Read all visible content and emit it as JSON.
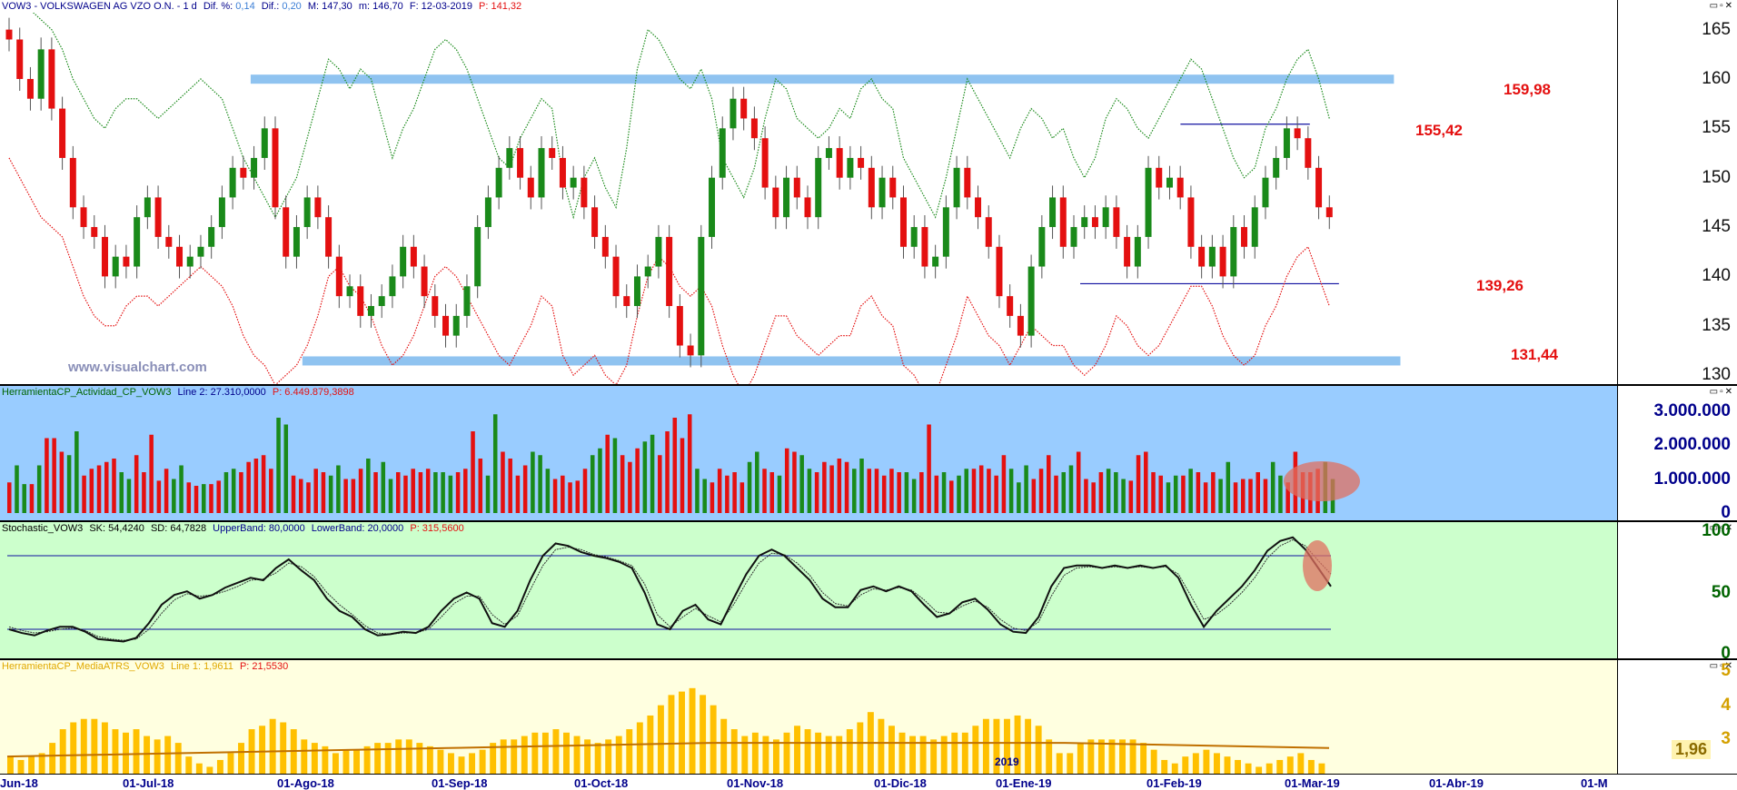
{
  "price_panel": {
    "header": {
      "symbol": "VOW3 - VOLKSWAGEN AG VZO O.N. - 1 d",
      "dif_pct_label": "Dif. %:",
      "dif_pct_value": "0,14",
      "dif_label": "Dif.:",
      "dif_value": "0,20",
      "max_label": "M: 147,30",
      "min_label": "m: 146,70",
      "date_label": "F: 12-03-2019",
      "p_label": "P: 141,32"
    },
    "watermark": "www.visualchart.com",
    "yticks": [
      "165",
      "160",
      "155",
      "150",
      "145",
      "140",
      "135",
      "130"
    ],
    "levels": [
      {
        "label": "159,98",
        "value": 159.98,
        "kind": "band",
        "start": 0.155,
        "end": 0.862
      },
      {
        "label": "155,42",
        "value": 155.42,
        "kind": "line",
        "start": 0.73,
        "end": 0.81
      },
      {
        "label": "139,26",
        "value": 139.26,
        "kind": "line",
        "start": 0.668,
        "end": 0.828
      },
      {
        "label": "131,44",
        "value": 131.44,
        "kind": "band",
        "start": 0.187,
        "end": 0.866
      }
    ],
    "colors": {
      "up": "#1a8a1a",
      "down": "#e41010",
      "upper_band": "#1a8a1a",
      "lower_band": "#e41010",
      "level": "#8fc3f0"
    }
  },
  "activity_panel": {
    "header": {
      "name": "HerramientaCP_Actividad_CP_VOW3",
      "line_label": "Line 2: 27.310,0000",
      "p_label": "P: 6.449.879,3898"
    },
    "yticks": [
      "3.000.000",
      "2.000.000",
      "1.000.000",
      "0"
    ],
    "background": "#99ccff"
  },
  "stochastic_panel": {
    "header": {
      "name": "Stochastic_VOW3",
      "sk_label": "SK: 54,4240",
      "sd_label": "SD: 64,7828",
      "upper_label": "UpperBand: 80,0000",
      "lower_label": "LowerBand: 20,0000",
      "p_label": "P: 315,5600"
    },
    "yticks": [
      "100",
      "50",
      "0"
    ],
    "upper_band": 80,
    "lower_band": 20,
    "background": "#ccffcc"
  },
  "atr_panel": {
    "header": {
      "name": "HerramientaCP_MediaATRS_VOW3",
      "line_label": "Line 1: 1,9611",
      "p_label": "P: 21,5530"
    },
    "yticks": [
      "5",
      "4",
      "3"
    ],
    "last_value_label": "1,96",
    "year_marker": "2019",
    "background": "#ffffe0",
    "bar_color": "#ffc000",
    "line_color": "#c07000"
  },
  "x_axis": {
    "labels": [
      "Jun-18",
      "01-Jul-18",
      "01-Ago-18",
      "01-Sep-18",
      "01-Oct-18",
      "01-Nov-18",
      "01-Dic-18",
      "01-Ene-19",
      "01-Feb-19",
      "01-Mar-19",
      "01-Abr-19",
      "01-M"
    ]
  },
  "chart_data": [
    {
      "type": "candlestick",
      "title": "VOW3 - VOLKSWAGEN AG VZO O.N. - 1 d",
      "ylim": [
        129,
        168
      ],
      "candles_estimated": true,
      "close": [
        164,
        160,
        158,
        163,
        157,
        152,
        147,
        145,
        144,
        140,
        142,
        141,
        146,
        148,
        144,
        143,
        141,
        142,
        143,
        145,
        148,
        151,
        150,
        152,
        155,
        147,
        142,
        145,
        148,
        146,
        142,
        138,
        139,
        136,
        137,
        138,
        140,
        143,
        141,
        138,
        136,
        134,
        136,
        139,
        145,
        148,
        151,
        153,
        150,
        148,
        153,
        152,
        149,
        150,
        147,
        144,
        142,
        138,
        137,
        140,
        141,
        144,
        137,
        133,
        132,
        144,
        150,
        155,
        158,
        156,
        154,
        149,
        146,
        150,
        148,
        146,
        152,
        153,
        150,
        152,
        151,
        147,
        150,
        148,
        143,
        145,
        141,
        142,
        147,
        151,
        148,
        146,
        143,
        138,
        136,
        134,
        141,
        145,
        148,
        143,
        145,
        146,
        145,
        147,
        144,
        141,
        144,
        151,
        149,
        150,
        148,
        143,
        141,
        143,
        140,
        145,
        143,
        147,
        150,
        152,
        155,
        154,
        151,
        147,
        146
      ],
      "ma_upper": [
        170,
        168,
        167,
        166,
        165,
        163,
        160,
        158,
        156,
        155,
        157,
        158,
        158,
        157,
        156,
        157,
        158,
        159,
        160,
        159,
        158,
        155,
        152,
        150,
        148,
        146,
        148,
        150,
        154,
        158,
        162,
        161,
        159,
        161,
        160,
        156,
        152,
        155,
        157,
        160,
        163,
        164,
        163,
        161,
        158,
        155,
        152,
        151,
        154,
        156,
        158,
        157,
        150,
        146,
        150,
        152,
        149,
        147,
        153,
        161,
        165,
        164,
        162,
        160,
        159,
        161,
        158,
        152,
        150,
        148,
        151,
        156,
        160,
        159,
        156,
        155,
        154,
        155,
        157,
        156,
        159,
        160,
        158,
        157,
        152,
        150,
        148,
        146,
        150,
        155,
        160,
        158,
        156,
        154,
        152,
        155,
        157,
        156,
        154,
        155,
        152,
        150,
        152,
        156,
        158,
        157,
        155,
        154,
        156,
        158,
        160,
        162,
        161,
        158,
        155,
        152,
        150,
        151,
        155,
        157,
        160,
        162,
        163,
        160,
        156
      ],
      "ma_lower": [
        152,
        150,
        148,
        146,
        145,
        144,
        141,
        138,
        136,
        135,
        135,
        137,
        138,
        138,
        137,
        138,
        139,
        140,
        141,
        140,
        139,
        137,
        134,
        132,
        131,
        129,
        130,
        131,
        133,
        136,
        140,
        141,
        139,
        138,
        136,
        133,
        131,
        132,
        134,
        137,
        140,
        141,
        140,
        138,
        136,
        134,
        132,
        131,
        133,
        135,
        138,
        137,
        132,
        130,
        131,
        132,
        130,
        129,
        131,
        136,
        140,
        142,
        141,
        139,
        138,
        139,
        137,
        133,
        130,
        128,
        130,
        133,
        136,
        136,
        134,
        133,
        132,
        133,
        134,
        134,
        137,
        138,
        136,
        135,
        131,
        130,
        128,
        128,
        131,
        134,
        138,
        136,
        134,
        133,
        131,
        133,
        135,
        134,
        133,
        133,
        131,
        130,
        131,
        133,
        136,
        135,
        133,
        132,
        133,
        135,
        137,
        139,
        139,
        137,
        134,
        132,
        131,
        132,
        135,
        137,
        140,
        142,
        143,
        140,
        137
      ]
    },
    {
      "type": "bar",
      "title": "HerramientaCP_Actividad_CP_VOW3",
      "ylim": [
        0,
        3200000
      ],
      "values_estimated": true,
      "values": [
        900000,
        1400000,
        850000,
        850000,
        1400000,
        2200000,
        2200000,
        1800000,
        1700000,
        2400000,
        1100000,
        1300000,
        1400000,
        1500000,
        1600000,
        1200000,
        1000000,
        1700000,
        1200000,
        2300000,
        950000,
        1300000,
        1000000,
        1400000,
        900000,
        800000,
        850000,
        850000,
        950000,
        1200000,
        1300000,
        1200000,
        1500000,
        1600000,
        1700000,
        1300000,
        2800000,
        2600000,
        1100000,
        1000000,
        900000,
        1300000,
        1200000,
        1100000,
        1400000,
        1000000,
        1000000,
        1300000,
        1600000,
        1200000,
        1500000,
        1000000,
        1200000,
        1100000,
        1300000,
        1200000,
        1300000,
        1200000,
        1200000,
        1100000,
        1200000,
        1300000,
        2400000,
        1600000,
        1100000,
        2900000,
        1800000,
        1600000,
        1100000,
        1400000,
        1800000,
        1700000,
        1300000,
        1000000,
        1100000,
        900000,
        950000,
        1300000,
        1700000,
        1900000,
        2300000,
        2200000,
        1700000,
        1500000,
        1900000,
        2100000,
        2300000,
        1700000,
        2400000,
        2800000,
        2200000,
        2900000,
        1300000,
        1000000,
        900000,
        1300000,
        1100000,
        1200000,
        900000,
        1500000,
        1800000,
        1300000,
        1200000,
        1100000,
        1900000,
        1800000,
        1700000,
        1300000,
        1200000,
        1500000,
        1400000,
        1600000,
        1500000,
        1300000,
        1600000,
        1300000,
        1300000,
        1100000,
        1300000,
        1200000,
        1200000,
        1000000,
        1200000,
        2600000,
        1100000,
        1200000,
        950000,
        1100000,
        1300000,
        1300000,
        1400000,
        1300000,
        1100000,
        1700000,
        1300000,
        900000,
        1400000,
        1000000,
        1300000,
        1700000,
        1100000,
        1200000,
        1400000,
        1800000,
        1000000,
        900000,
        1200000,
        1300000,
        1200000,
        1000000,
        950000,
        1700000,
        1800000,
        1200000,
        1100000,
        900000,
        1100000,
        1100000,
        1300000,
        1200000,
        900000,
        1200000,
        1000000,
        1500000,
        900000,
        1000000,
        1000000,
        1200000,
        1000000,
        1500000,
        1100000,
        900000,
        1800000,
        1200000,
        1200000,
        1300000,
        1500000,
        1000000
      ],
      "colors_pattern": "mixed red/green"
    },
    {
      "type": "line",
      "title": "Stochastic_VOW3",
      "ylim": [
        0,
        100
      ],
      "values_estimated": true,
      "series": [
        {
          "name": "SK",
          "values": [
            20,
            17,
            15,
            19,
            22,
            22,
            18,
            12,
            11,
            10,
            13,
            25,
            40,
            48,
            51,
            45,
            48,
            54,
            58,
            62,
            60,
            70,
            77,
            68,
            60,
            45,
            35,
            30,
            20,
            15,
            16,
            18,
            17,
            22,
            35,
            45,
            50,
            45,
            25,
            22,
            35,
            60,
            80,
            90,
            88,
            83,
            80,
            78,
            75,
            70,
            50,
            24,
            20,
            35,
            40,
            28,
            24,
            45,
            65,
            80,
            85,
            80,
            70,
            60,
            45,
            38,
            38,
            52,
            55,
            51,
            55,
            51,
            40,
            30,
            33,
            42,
            45,
            36,
            24,
            18,
            17,
            30,
            55,
            70,
            72,
            72,
            70,
            72,
            70,
            72,
            70,
            72,
            62,
            40,
            22,
            35,
            45,
            55,
            68,
            84,
            92,
            95,
            85,
            70,
            55
          ]
        },
        {
          "name": "SD",
          "values": [
            22,
            19,
            17,
            18,
            20,
            21,
            19,
            14,
            12,
            11,
            12,
            20,
            33,
            44,
            49,
            47,
            48,
            51,
            55,
            60,
            61,
            66,
            74,
            71,
            63,
            50,
            40,
            32,
            23,
            17,
            16,
            17,
            17,
            20,
            30,
            41,
            47,
            47,
            32,
            24,
            31,
            52,
            72,
            85,
            87,
            85,
            81,
            79,
            76,
            72,
            57,
            32,
            22,
            30,
            37,
            31,
            26,
            40,
            58,
            74,
            82,
            81,
            74,
            64,
            50,
            41,
            39,
            48,
            53,
            52,
            54,
            52,
            44,
            34,
            33,
            39,
            43,
            38,
            28,
            21,
            19,
            26,
            47,
            64,
            70,
            71,
            70,
            71,
            70,
            71,
            70,
            71,
            65,
            47,
            28,
            32,
            40,
            50,
            62,
            78,
            88,
            93,
            88,
            76,
            65
          ]
        }
      ]
    },
    {
      "type": "bar",
      "title": "HerramientaCP_MediaATRS_VOW3",
      "ylim": [
        2,
        5
      ],
      "values_estimated": true,
      "values": [
        2.5,
        2.4,
        2.5,
        2.6,
        2.9,
        3.3,
        3.5,
        3.6,
        3.6,
        3.5,
        3.3,
        3.2,
        3.3,
        3.1,
        3.0,
        3.1,
        2.9,
        2.5,
        2.3,
        2.2,
        2.4,
        2.6,
        2.9,
        3.3,
        3.4,
        3.6,
        3.5,
        3.3,
        3.0,
        2.9,
        2.8,
        2.6,
        2.7,
        2.7,
        2.8,
        2.9,
        2.9,
        3.0,
        3.0,
        2.9,
        2.8,
        2.7,
        2.6,
        2.5,
        2.6,
        2.7,
        2.9,
        3.0,
        3.0,
        3.1,
        3.2,
        3.2,
        3.3,
        3.2,
        3.1,
        3.0,
        2.9,
        3.0,
        3.1,
        3.3,
        3.5,
        3.7,
        4.0,
        4.3,
        4.4,
        4.5,
        4.3,
        4.0,
        3.6,
        3.3,
        3.1,
        3.2,
        3.1,
        3.0,
        3.2,
        3.4,
        3.3,
        3.2,
        3.1,
        3.1,
        3.3,
        3.5,
        3.8,
        3.6,
        3.4,
        3.2,
        3.1,
        3.1,
        3.0,
        3.1,
        3.2,
        3.2,
        3.4,
        3.6,
        3.6,
        3.6,
        3.7,
        3.6,
        3.4,
        3.0,
        2.6,
        2.6,
        2.9,
        3.0,
        3.0,
        3.0,
        3.0,
        3.0,
        2.9,
        2.7,
        2.4,
        2.3,
        2.5,
        2.6,
        2.7,
        2.6,
        2.5,
        2.4,
        2.3,
        2.2,
        2.3,
        2.4,
        2.5,
        2.6,
        2.4,
        2.3
      ],
      "ma_values": [
        2.5,
        2.55,
        2.6,
        2.65,
        2.7,
        2.75,
        2.8,
        2.85,
        2.9,
        2.9,
        2.9,
        2.9,
        2.9,
        2.85,
        2.8,
        2.75
      ]
    }
  ]
}
